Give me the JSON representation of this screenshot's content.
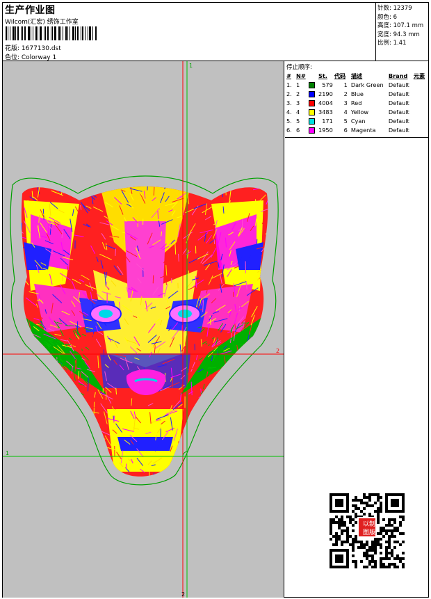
{
  "header": {
    "title": "生产作业图",
    "software": "Wilcom(汇宏) 绣饰工作室",
    "design_label": "花版: 1677130.dst",
    "colorway_label": "色位: Colorway 1"
  },
  "stats": {
    "stitches": "针数: 12379",
    "colors": "颜色: 6",
    "height": "高度: 107.1 mm",
    "width": "宽度: 94.3 mm",
    "scale": "比例: 1.41"
  },
  "axes": {
    "top_marker": "1",
    "bottom_marker": "2",
    "left_marker": "1",
    "right_marker": "2"
  },
  "color_table": {
    "title": "停止顺序:",
    "headers": [
      "#",
      "N#",
      "St.",
      "代码",
      "描述",
      "Brand",
      "元素"
    ],
    "rows": [
      {
        "idx": "1.",
        "n": "1",
        "color": "#008000",
        "st": "579",
        "code": "1",
        "desc": "Dark Green",
        "brand": "Default"
      },
      {
        "idx": "2.",
        "n": "2",
        "color": "#0000ff",
        "st": "2190",
        "code": "2",
        "desc": "Blue",
        "brand": "Default"
      },
      {
        "idx": "3.",
        "n": "3",
        "color": "#ff0000",
        "st": "4004",
        "code": "3",
        "desc": "Red",
        "brand": "Default"
      },
      {
        "idx": "4.",
        "n": "4",
        "color": "#ffff00",
        "st": "3483",
        "code": "4",
        "desc": "Yellow",
        "brand": "Default"
      },
      {
        "idx": "5.",
        "n": "5",
        "color": "#00e0e0",
        "st": "171",
        "code": "5",
        "desc": "Cyan",
        "brand": "Default"
      },
      {
        "idx": "6.",
        "n": "6",
        "color": "#ff00ff",
        "st": "1950",
        "code": "6",
        "desc": "Magenta",
        "brand": "Default"
      }
    ]
  },
  "qr": {
    "seal_text": [
      "以",
      "图",
      "制",
      "版"
    ]
  }
}
